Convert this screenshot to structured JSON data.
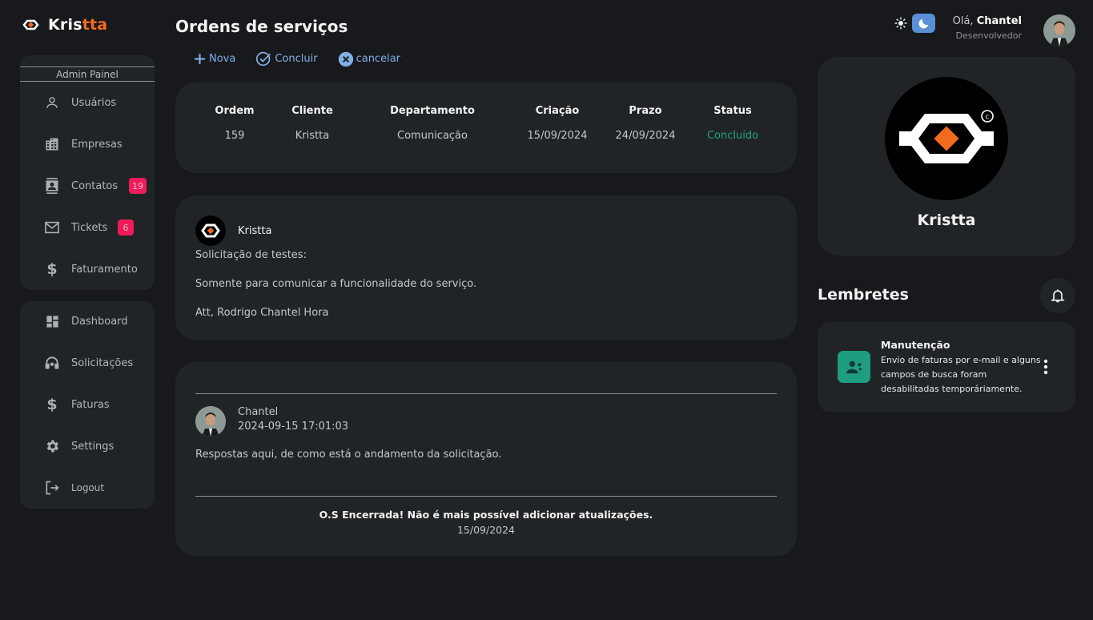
{
  "brand": {
    "name_part1": "Kris",
    "name_part2": "tta",
    "accent_color": "#f26b1d"
  },
  "sidebar": {
    "admin_label": "Admin Painel",
    "items": [
      {
        "label": "Usuários",
        "icon": "person-icon"
      },
      {
        "label": "Empresas",
        "icon": "building-icon"
      },
      {
        "label": "Contatos",
        "icon": "contacts-icon",
        "badge": "19"
      },
      {
        "label": "Tickets",
        "icon": "mail-icon",
        "badge": "6"
      },
      {
        "label": "Faturamento",
        "icon": "dollar-icon"
      }
    ],
    "items2": [
      {
        "label": "Dashboard",
        "icon": "dashboard-icon"
      },
      {
        "label": "Solicitações",
        "icon": "headset-icon"
      },
      {
        "label": "Faturas",
        "icon": "dollar-icon"
      },
      {
        "label": "Settings",
        "icon": "gear-icon"
      },
      {
        "label": "Logout",
        "icon": "logout-icon"
      }
    ]
  },
  "header": {
    "title": "Ordens de serviços",
    "actions": {
      "new": "Nova",
      "complete": "Concluir",
      "cancel": "cancelar"
    }
  },
  "orders": {
    "columns": [
      "Ordem",
      "Cliente",
      "Departamento",
      "Criação",
      "Prazo",
      "Status"
    ],
    "row": [
      "159",
      "Kristta",
      "Comunicação",
      "15/09/2024",
      "24/09/2024",
      "Concluído"
    ],
    "status_color": "#1fa582"
  },
  "message": {
    "author": "Kristta",
    "lines": [
      "Solicitação de testes:",
      "Somente para comunicar a funcionalidade do serviço.",
      "Att, Rodrigo Chantel Hora"
    ]
  },
  "reply": {
    "name": "Chantel",
    "timestamp": "2024-09-15 17:01:03",
    "text": "Respostas aqui, de como está o andamento da solicitação.",
    "closed_message": "O.S Encerrada! Não é mais possível adicionar atualizações.",
    "closed_date": "15/09/2024"
  },
  "user": {
    "greeting": "Olá,",
    "name": "Chantel",
    "role": "Desenvolvedor"
  },
  "company": {
    "name": "Kristta"
  },
  "reminders": {
    "title": "Lembretes",
    "items": [
      {
        "title": "Manutenção",
        "body": "Envio de faturas por e-mail e alguns campos de busca foram desabilitadas temporáriamente.",
        "icon": "maintenance-icon"
      }
    ]
  }
}
